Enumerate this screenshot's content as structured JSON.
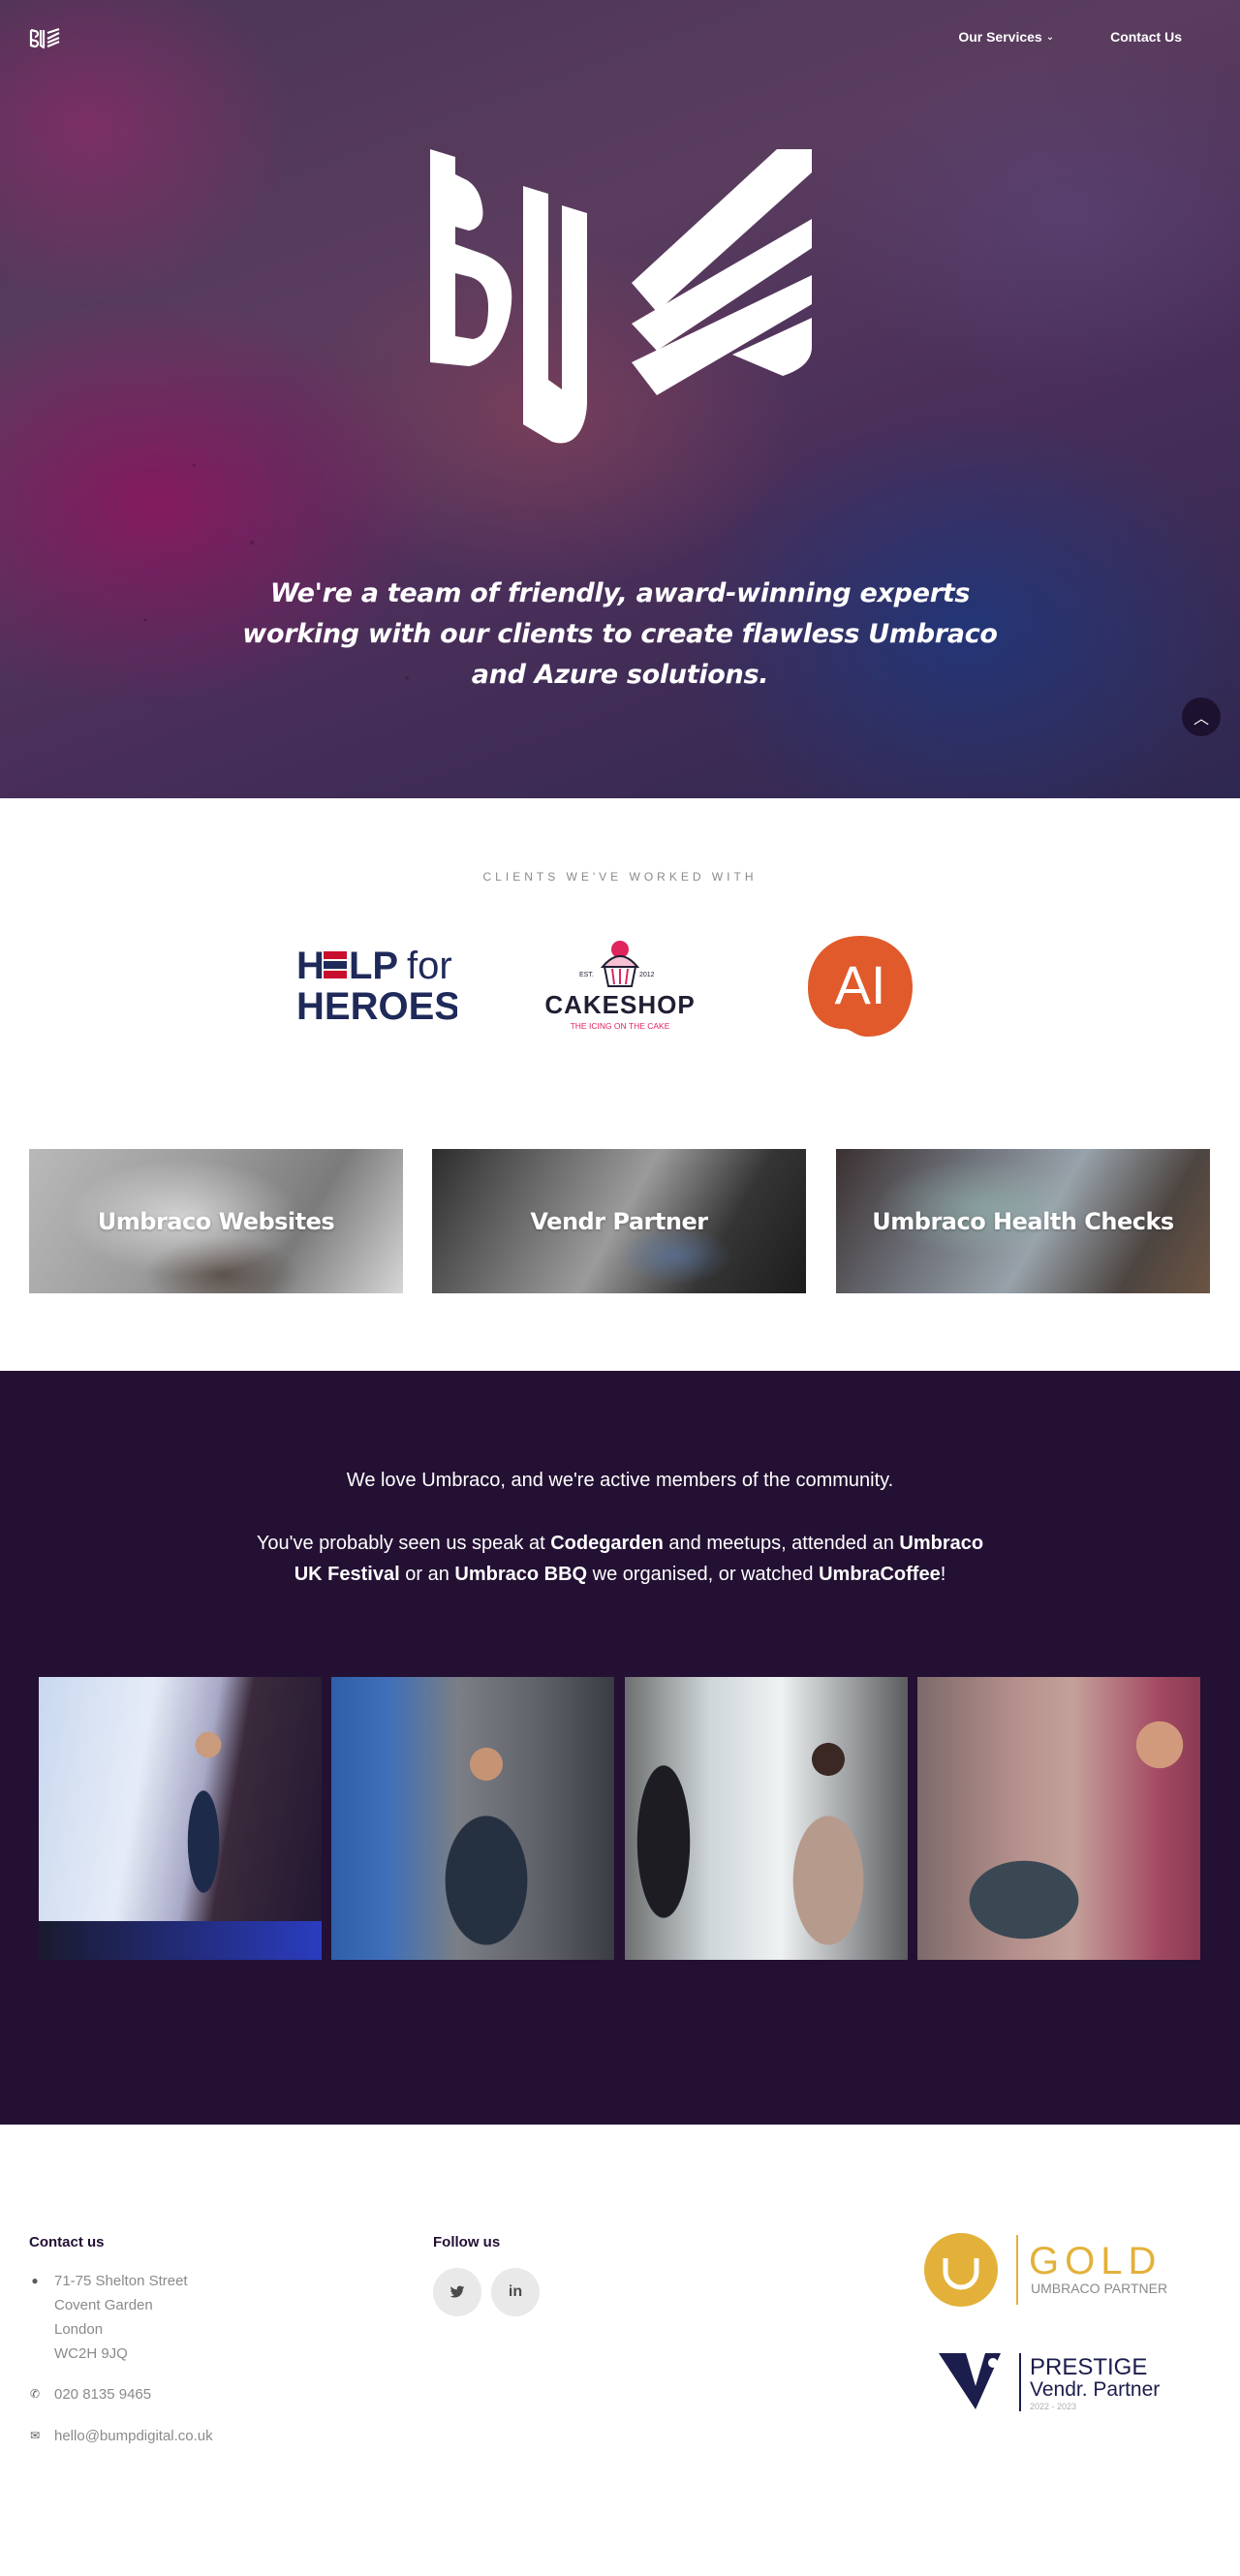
{
  "nav": {
    "logo": "BUMP",
    "items": [
      {
        "label": "Our Services",
        "has_dropdown": true
      },
      {
        "label": "Contact Us",
        "has_dropdown": false
      }
    ]
  },
  "hero": {
    "logo": "BUMP",
    "tagline": "We're a team of friendly, award-winning experts working with our clients to create flawless Umbraco and Azure solutions.",
    "scroll_icon": "chevron-up-icon"
  },
  "clients": {
    "heading": "CLIENTS WE'VE WORKED WITH",
    "logos": [
      {
        "name": "Help for Heroes",
        "line1_a": "H",
        "line1_b": "LP",
        "line1_c": "for",
        "line2": "HEROES"
      },
      {
        "name": "Cakeshop",
        "est": "EST.",
        "year": "2012",
        "wordmark": "CAKESHOP",
        "strap": "THE ICING ON THE CAKE"
      },
      {
        "name": "AI",
        "mark": "AI"
      }
    ]
  },
  "services": [
    {
      "label": "Umbraco Websites"
    },
    {
      "label": "Vendr Partner"
    },
    {
      "label": "Umbraco Health Checks"
    }
  ],
  "community": {
    "intro": "We love Umbraco, and we're active members of the community.",
    "p2_a": "You've probably seen us speak at ",
    "p2_b": "Codegarden",
    "p2_c": " and meetups, attended an ",
    "p2_d": "Umbraco UK Festival",
    "p2_e": " or an ",
    "p2_f": "Umbraco BBQ",
    "p2_g": " we organised, or watched ",
    "p2_h": "UmbraCoffee",
    "p2_i": "!"
  },
  "footer": {
    "contact_heading": "Contact us",
    "address": [
      "71-75 Shelton Street",
      "Covent Garden",
      "London",
      "WC2H 9JQ"
    ],
    "phone": "020 8135 9465",
    "email": "hello@bumpdigital.co.uk",
    "follow_heading": "Follow us",
    "social": [
      {
        "name": "twitter-icon",
        "glyph": "t"
      },
      {
        "name": "linkedin-icon",
        "glyph": "in"
      }
    ],
    "badges": {
      "gold_word": "GOLD",
      "gold_sub": "UMBRACO PARTNER",
      "prestige_word": "PRESTIGE",
      "prestige_sub": "Vendr. Partner",
      "prestige_years": "2022 - 2023"
    }
  },
  "colors": {
    "dark_purple": "#231033",
    "gold": "#e3b13a",
    "hfh_red": "#c8102e",
    "cakeshop_pink": "#e0245e",
    "ai_orange": "#e05a2b"
  }
}
